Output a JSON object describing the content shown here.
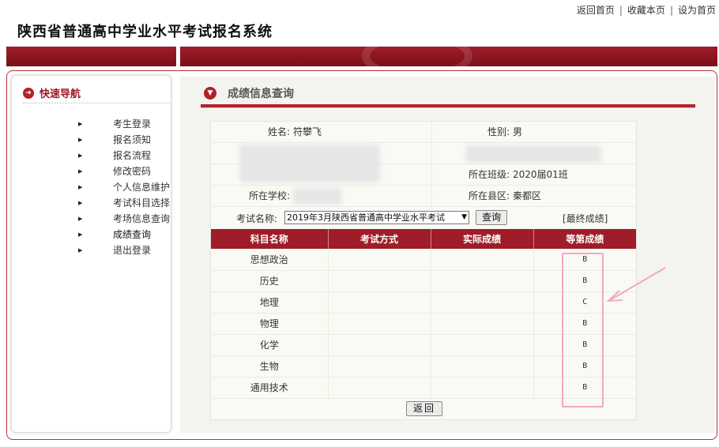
{
  "toplinks": {
    "home": "返回首页",
    "fav": "收藏本页",
    "sethome": "设为首页",
    "sep": "|"
  },
  "site": {
    "title": "陕西省普通高中学业水平考试报名系统"
  },
  "nav": {
    "title": "快速导航",
    "items": [
      "考生登录",
      "报名须知",
      "报名流程",
      "修改密码",
      "个人信息维护",
      "考试科目选择",
      "考场信息查询",
      "成绩查询",
      "退出登录"
    ]
  },
  "main": {
    "title": "成绩信息查询"
  },
  "student": {
    "name_label": "姓名:",
    "name_value": "符攀飞",
    "gender_label": "性别:",
    "gender_value": "男",
    "class_label": "所在班级:",
    "class_value": "2020届01班",
    "school_label": "所在学校:",
    "county_label": "所在县区:",
    "county_value": "秦都区"
  },
  "query": {
    "label": "考试名称:",
    "selected": "2019年3月陕西省普通高中学业水平考试",
    "button": "查询",
    "final": "[最终成绩]"
  },
  "table": {
    "headers": [
      "科目名称",
      "考试方式",
      "实际成绩",
      "等第成绩"
    ],
    "rows": [
      {
        "subject": "思想政治",
        "mode": "",
        "score": "",
        "grade": "B"
      },
      {
        "subject": "历史",
        "mode": "",
        "score": "",
        "grade": "B"
      },
      {
        "subject": "地理",
        "mode": "",
        "score": "",
        "grade": "C"
      },
      {
        "subject": "物理",
        "mode": "",
        "score": "",
        "grade": "B"
      },
      {
        "subject": "化学",
        "mode": "",
        "score": "",
        "grade": "B"
      },
      {
        "subject": "生物",
        "mode": "",
        "score": "",
        "grade": "B"
      },
      {
        "subject": "通用技术",
        "mode": "",
        "score": "",
        "grade": "B"
      }
    ]
  },
  "back": {
    "label": "返回"
  },
  "colors": {
    "brand": "#9e1d28",
    "highlight": "#f2a8c4"
  },
  "icons": {
    "nav_head": "arrow-right-circle-icon",
    "main_head": "arrow-down-circle-icon",
    "bullet": "triangle-right-icon"
  }
}
